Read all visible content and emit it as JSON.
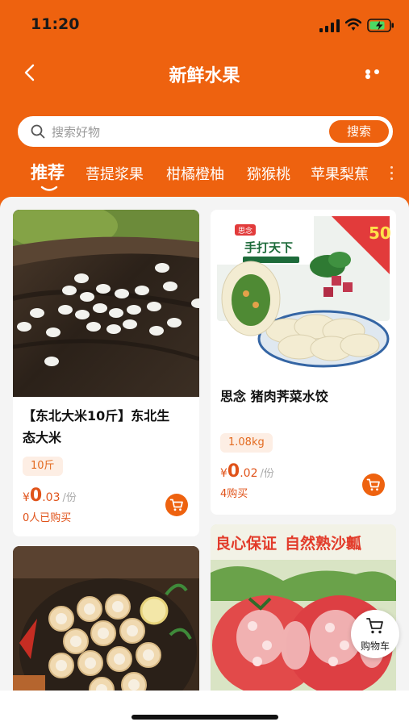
{
  "status_bar": {
    "time": "11:20"
  },
  "header": {
    "title": "新鲜水果"
  },
  "search": {
    "placeholder": "搜索好物",
    "button_label": "搜索"
  },
  "tabs": [
    {
      "label": "推荐",
      "active": true
    },
    {
      "label": "菩提浆果"
    },
    {
      "label": "柑橘橙柚"
    },
    {
      "label": "猕猴桃"
    },
    {
      "label": "苹果梨蕉"
    }
  ],
  "products": [
    {
      "name_line1": "【东北大米10斤】东北生",
      "name_line2": "态大米",
      "spec": "10斤",
      "currency": "¥",
      "price_int": "0",
      "price_dec": ".03",
      "unit": "/份",
      "sold": "0人已购买"
    },
    {
      "name_line1": "思念 猪肉荠菜水饺",
      "spec": "1.08kg",
      "currency": "¥",
      "price_int": "0",
      "price_dec": ".02",
      "unit": "/份",
      "sold": "4购买",
      "image_text": {
        "brand": "思念",
        "banner": "50",
        "brand_mark": "手打天下"
      }
    },
    {
      "image": "scallops"
    },
    {
      "image_text": {
        "slogan_left": "良心保证",
        "slogan_right": "自然熟沙瓤"
      }
    }
  ],
  "floating_cart": {
    "label": "购物车"
  },
  "colors": {
    "brand": "#ee620f",
    "price": "#e0531a",
    "tag_bg": "#fdeee4"
  }
}
